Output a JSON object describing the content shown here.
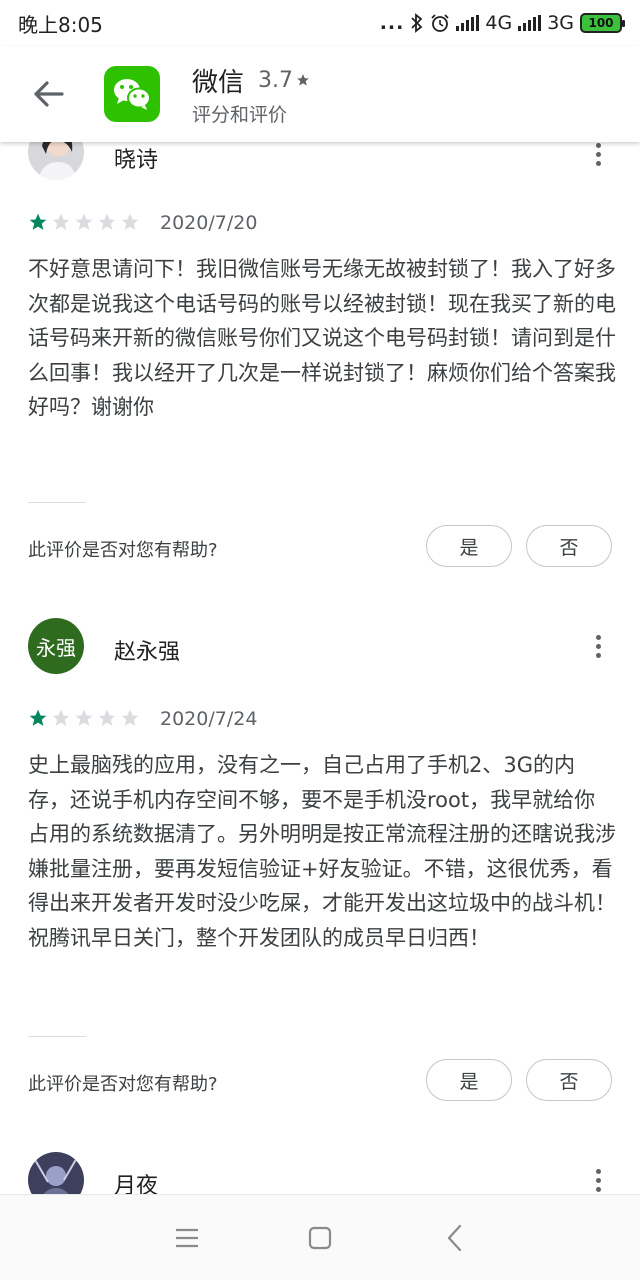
{
  "status_bar": {
    "time": "晚上8:05",
    "dots": "...",
    "network_1": "4G",
    "network_2": "3G",
    "battery": "100"
  },
  "header": {
    "app_name": "微信",
    "rating": "3.7",
    "subtitle": "评分和评价",
    "app_icon_color": "#2dc100"
  },
  "reviews": [
    {
      "name": "晓诗",
      "stars": 1,
      "date": "2020/7/20",
      "text": "不好意思请问下！我旧微信账号无缘无故被封锁了！我入了好多次都是说我这个电话号码的账号以经被封锁！现在我买了新的电话号码来开新的微信账号你们又说这个电号码封锁！请问到是什么回事！我以经开了几次是一样说封锁了！麻烦你们给个答案我好吗？谢谢你",
      "helpful_question": "此评价是否对您有帮助?",
      "yes_label": "是",
      "no_label": "否"
    },
    {
      "name": "赵永强",
      "avatar_text": "永强",
      "avatar_color": "#2e6b1f",
      "stars": 1,
      "date": "2020/7/24",
      "text": "史上最脑残的应用，没有之一，自己占用了手机2、3G的内存，还说手机内存空间不够，要不是手机没root，我早就给你占用的系统数据清了。另外明明是按正常流程注册的还瞎说我涉嫌批量注册，要再发短信验证+好友验证。不错，这很优秀，看得出来开发者开发时没少吃屎，才能开发出这垃圾中的战斗机！祝腾讯早日关门，整个开发团队的成员早日归西！",
      "helpful_question": "此评价是否对您有帮助?",
      "yes_label": "是",
      "no_label": "否"
    },
    {
      "name": "月夜"
    }
  ],
  "colors": {
    "star_filled": "#01875f",
    "star_empty": "#dadce0"
  },
  "icons": [
    "back-arrow-icon",
    "wechat-icon",
    "more-vert-icon",
    "star-icon",
    "menu-icon",
    "home-square-icon",
    "back-chevron-icon",
    "bluetooth-icon",
    "alarm-icon",
    "signal-icon",
    "battery-icon"
  ]
}
